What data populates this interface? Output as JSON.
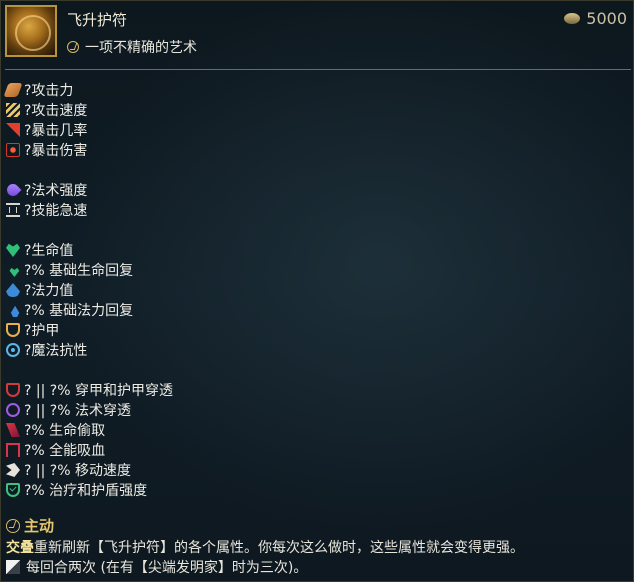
{
  "header": {
    "title": "飞升护符",
    "subtitle": "一项不精确的艺术",
    "price": "5000",
    "price_icon": "gold-coin-icon",
    "item_icon": "ascension-amulet-icon"
  },
  "stats": [
    {
      "name": "attack-damage",
      "icon": "attack-damage-icon",
      "text": "?攻击力"
    },
    {
      "name": "attack-speed",
      "icon": "attack-speed-icon",
      "text": "?攻击速度"
    },
    {
      "name": "crit-chance",
      "icon": "crit-chance-icon",
      "text": "?暴击几率"
    },
    {
      "name": "crit-damage",
      "icon": "crit-damage-icon",
      "text": "?暴击伤害"
    },
    null,
    {
      "name": "ability-power",
      "icon": "ability-power-icon",
      "text": "?法术强度"
    },
    {
      "name": "ability-haste",
      "icon": "hourglass-icon",
      "text": "?技能急速"
    },
    null,
    {
      "name": "health",
      "icon": "heart-icon",
      "text": "?生命值"
    },
    {
      "name": "health-regen",
      "icon": "health-regen-icon",
      "text": "?% 基础生命回复"
    },
    {
      "name": "mana",
      "icon": "mana-drop-icon",
      "text": "?法力值"
    },
    {
      "name": "mana-regen",
      "icon": "mana-regen-icon",
      "text": "?% 基础法力回复"
    },
    {
      "name": "armor",
      "icon": "armor-shield-icon",
      "text": "?护甲"
    },
    {
      "name": "magic-resist",
      "icon": "magic-resist-icon",
      "text": "?魔法抗性"
    },
    null,
    {
      "name": "armor-pen",
      "icon": "armor-pen-icon",
      "text": "? || ?% 穿甲和护甲穿透"
    },
    {
      "name": "magic-pen",
      "icon": "magic-pen-icon",
      "text": "? || ?% 法术穿透"
    },
    {
      "name": "life-steal",
      "icon": "life-steal-icon",
      "text": "?% 生命偷取"
    },
    {
      "name": "omnivamp",
      "icon": "omnivamp-icon",
      "text": "?% 全能吸血"
    },
    {
      "name": "move-speed",
      "icon": "move-speed-icon",
      "text": "? || ?% 移动速度"
    },
    {
      "name": "heal-shield-power",
      "icon": "heal-shield-icon",
      "text": "?% 治疗和护盾强度"
    }
  ],
  "active": {
    "label": "主动",
    "keyword": "交叠",
    "description": "重新刷新【飞升护符】的各个属性。你每次这么做时，这些属性就会变得更强。",
    "note": "每回合两次 (在有【尖端发明家】时为三次)。"
  },
  "colors": {
    "background": "#0f1a22",
    "accent_gold": "#e5c76b",
    "divider": "#7a6a3c"
  }
}
